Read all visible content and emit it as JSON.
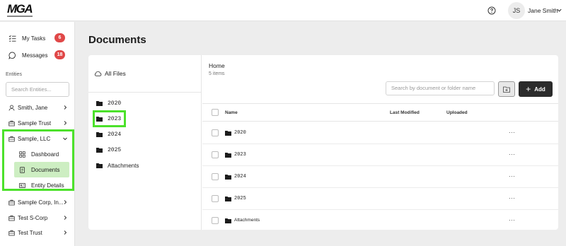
{
  "header": {
    "logo": "MGA",
    "user_initials": "JS",
    "user_name": "Jane Smith"
  },
  "sidebar": {
    "nav": [
      {
        "label": "My Tasks",
        "icon": "tasks-icon",
        "badge": "6"
      },
      {
        "label": "Messages",
        "icon": "chat-icon",
        "badge": "18"
      }
    ],
    "entities_label": "Entities",
    "search_placeholder": "Search Entities...",
    "entities": [
      {
        "label": "Smith, Jane",
        "icon": "person-icon"
      },
      {
        "label": "Sample Trust",
        "icon": "briefcase-icon"
      },
      {
        "label": "Sample, LLC",
        "icon": "briefcase-icon",
        "expanded": true
      },
      {
        "label": "Sample Corp, In...",
        "icon": "briefcase-icon"
      },
      {
        "label": "Test S-Corp",
        "icon": "briefcase-icon"
      },
      {
        "label": "Test Trust",
        "icon": "briefcase-icon"
      }
    ],
    "sub_items": [
      {
        "label": "Dashboard",
        "icon": "grid-icon"
      },
      {
        "label": "Documents",
        "icon": "document-icon",
        "active": true
      },
      {
        "label": "Entity Details",
        "icon": "id-card-icon"
      }
    ]
  },
  "main": {
    "title": "Documents",
    "all_files_label": "All Files",
    "folders": [
      "2020",
      "2023",
      "2024",
      "2025",
      "Attachments"
    ],
    "selected_folder": "2023",
    "home_title": "Home",
    "items_count": "5 items",
    "search_placeholder": "Search by document or folder name",
    "add_label": "Add",
    "columns": [
      "Name",
      "Last Modified",
      "Uploaded"
    ],
    "rows": [
      {
        "name": "2020"
      },
      {
        "name": "2023"
      },
      {
        "name": "2024"
      },
      {
        "name": "2025"
      },
      {
        "name": "Attachments"
      }
    ],
    "row_menu": "···"
  },
  "colors": {
    "highlight": "#4ce12b",
    "active_bg": "#cdeec2",
    "badge": "#e04848",
    "add_button": "#2b2b2b"
  }
}
